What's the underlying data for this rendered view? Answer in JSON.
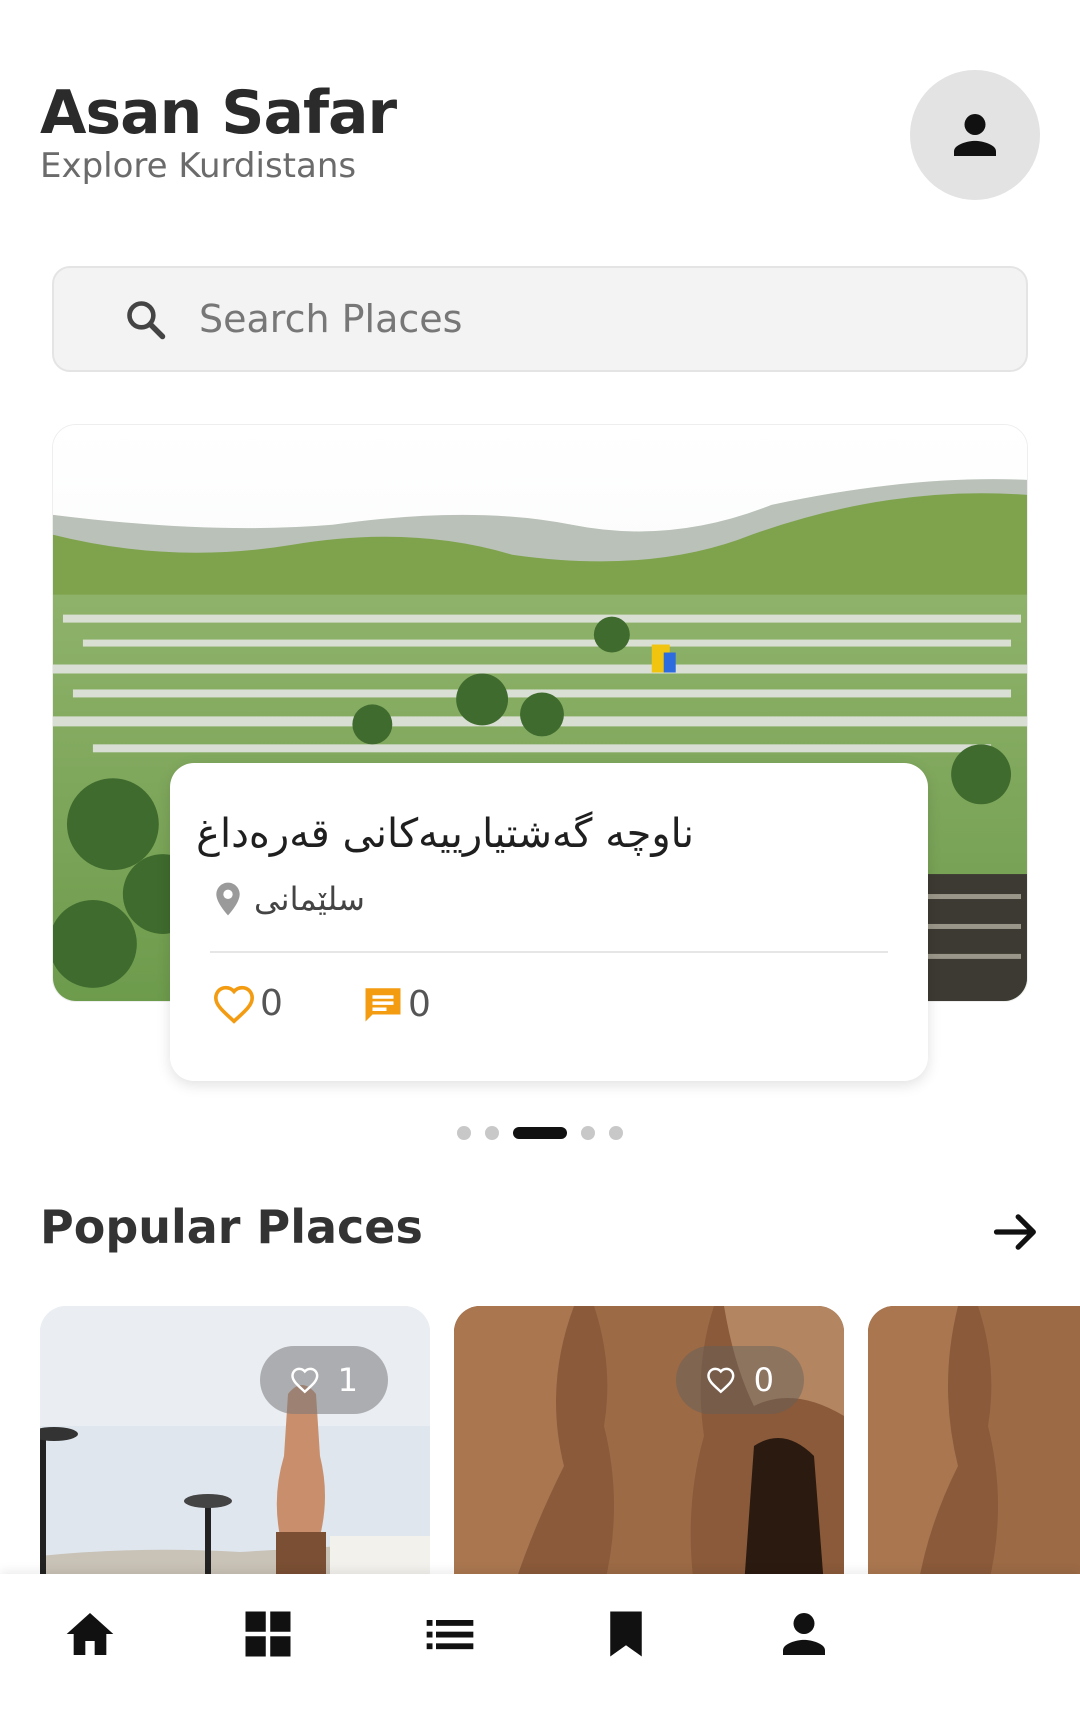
{
  "header": {
    "title": "Asan Safar",
    "subtitle": "Explore Kurdistans",
    "profile_icon": "person-icon"
  },
  "search": {
    "placeholder": "Search Places",
    "icon": "search-icon"
  },
  "featured": {
    "title": "ناوچە گەشتیارییەکانی قەرەداغ",
    "location": "سلێمانی",
    "likes": "0",
    "comments": "0",
    "accent_color": "#f39c12"
  },
  "carousel": {
    "dot_count": 5,
    "active_index": 2
  },
  "popular": {
    "title": "Popular Places",
    "arrow_icon": "arrow-right-icon",
    "cards": [
      {
        "likes": "1"
      },
      {
        "likes": "0"
      },
      {}
    ]
  },
  "bottom_nav": {
    "items": [
      {
        "icon": "home-icon"
      },
      {
        "icon": "grid-icon"
      },
      {
        "icon": "list-icon"
      },
      {
        "icon": "bookmark-icon"
      },
      {
        "icon": "person-icon"
      }
    ]
  }
}
